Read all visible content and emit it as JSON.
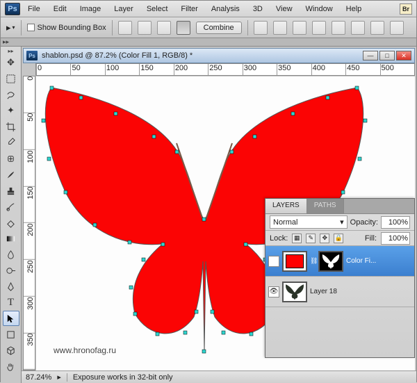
{
  "app": {
    "name": "Ps",
    "badge": "Br"
  },
  "menu": [
    "File",
    "Edit",
    "Image",
    "Layer",
    "Select",
    "Filter",
    "Analysis",
    "3D",
    "View",
    "Window",
    "Help"
  ],
  "options": {
    "show_bounding": "Show Bounding Box",
    "combine": "Combine"
  },
  "document": {
    "title": "shablon.psd @ 87.2% (Color Fill 1, RGB/8) *",
    "rulers_h": [
      "0",
      "50",
      "100",
      "150",
      "200",
      "250",
      "300",
      "350",
      "400",
      "450",
      "500"
    ],
    "rulers_v": [
      "0",
      "50",
      "100",
      "150",
      "200",
      "250",
      "300",
      "350"
    ],
    "watermark": "www.hronofag.ru"
  },
  "layers_panel": {
    "tab_layers": "LAYERS",
    "tab_paths": "PATHS",
    "blend_mode": "Normal",
    "opacity_label": "Opacity:",
    "opacity_value": "100%",
    "lock_label": "Lock:",
    "fill_label": "Fill:",
    "fill_value": "100%",
    "layer1_name": "Color Fi...",
    "layer2_name": "Layer 18"
  },
  "status": {
    "zoom": "87.24%",
    "msg": "Exposure works in 32-bit only"
  }
}
